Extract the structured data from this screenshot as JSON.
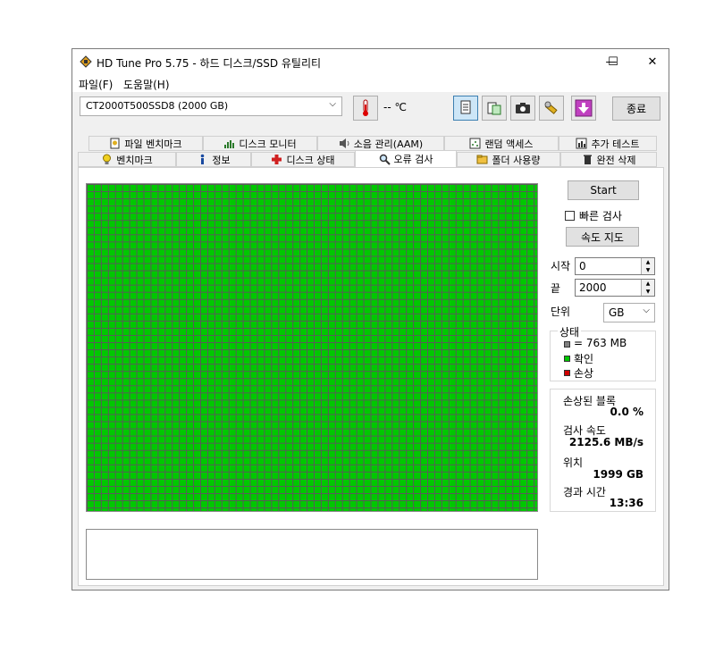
{
  "window": {
    "title": "HD Tune Pro 5.75 - 하드 디스크/SSD 유틸리티",
    "minimize": "—",
    "maximize": "☐",
    "close": "✕"
  },
  "menu": {
    "file": "파일(F)",
    "help": "도움말(H)"
  },
  "toolbar": {
    "drive": "CT2000T500SSD8 (2000 GB)",
    "temperature": "-- ℃",
    "exit": "종료"
  },
  "tabs_top": [
    {
      "label": "파일 벤치마크",
      "icon": "file-benchmark-icon"
    },
    {
      "label": "디스크 모니터",
      "icon": "disk-monitor-icon"
    },
    {
      "label": "소음 관리(AAM)",
      "icon": "speaker-icon"
    },
    {
      "label": "랜덤 액세스",
      "icon": "random-access-icon"
    },
    {
      "label": "추가 테스트",
      "icon": "extra-tests-icon"
    }
  ],
  "tabs_bottom": [
    {
      "label": "벤치마크",
      "icon": "bulb-icon"
    },
    {
      "label": "정보",
      "icon": "info-icon"
    },
    {
      "label": "디스크 상태",
      "icon": "health-cross-icon"
    },
    {
      "label": "오류 검사",
      "icon": "magnifier-icon"
    },
    {
      "label": "폴더 사용량",
      "icon": "folder-icon"
    },
    {
      "label": "완전 삭제",
      "icon": "trash-icon"
    }
  ],
  "error_scan": {
    "start_label": "Start",
    "quick_scan_label": "빠른 검사",
    "quick_scan_checked": false,
    "speed_map_label": "속도 지도",
    "start_field_label": "시작",
    "start_value": "0",
    "end_field_label": "끝",
    "end_value": "2000",
    "unit_label": "단위",
    "unit_value": "GB",
    "status_group_label": "상태",
    "legend_block": "= 763 MB",
    "legend_ok": "확인",
    "legend_damaged": "손상",
    "damaged_blocks_label": "손상된 블록",
    "damaged_blocks_value": "0.0 %",
    "scan_speed_label": "검사 속도",
    "scan_speed_value": "2125.6 MB/s",
    "position_label": "위치",
    "position_value": "1999 GB",
    "elapsed_label": "경과 시간",
    "elapsed_value": "13:36"
  },
  "colors": {
    "ok": "#00c800",
    "damaged": "#d00000",
    "block": "#808080"
  }
}
